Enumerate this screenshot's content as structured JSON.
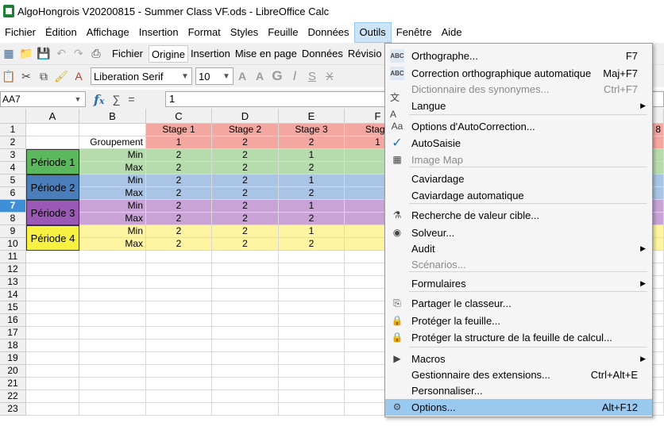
{
  "window": {
    "title": "AlgoHongrois V20200815  - Summer Class VF.ods - LibreOffice Calc"
  },
  "menubar": [
    "Fichier",
    "Édition",
    "Affichage",
    "Insertion",
    "Format",
    "Styles",
    "Feuille",
    "Données",
    "Outils",
    "Fenêtre",
    "Aide"
  ],
  "tabs": [
    "Fichier",
    "Origine",
    "Insertion",
    "Mise en page",
    "Données",
    "Révisio"
  ],
  "font": {
    "name": "Liberation Serif",
    "size": "10"
  },
  "formula": {
    "cell_ref": "AA7",
    "content": "1"
  },
  "columns": [
    "A",
    "B",
    "C",
    "D",
    "E",
    "F"
  ],
  "header_row1": [
    "Stage 1",
    "Stage 2",
    "Stage 3",
    "Stage"
  ],
  "header_row2": {
    "groupement": "Groupement",
    "values": [
      "1",
      "2",
      "2",
      "1"
    ]
  },
  "right_edge_label": "8",
  "periods": [
    {
      "name": "Période 1",
      "min": [
        "2",
        "2",
        "1"
      ],
      "max": [
        "2",
        "2",
        "2"
      ],
      "color": "#5cb85c",
      "light": "#b6dcae"
    },
    {
      "name": "Période 2",
      "min": [
        "2",
        "2",
        "1"
      ],
      "max": [
        "2",
        "2",
        "2"
      ],
      "color": "#4a7ebb",
      "light": "#a9c4e4"
    },
    {
      "name": "Période 3",
      "min": [
        "2",
        "2",
        "1"
      ],
      "max": [
        "2",
        "2",
        "2"
      ],
      "color": "#9b59b6",
      "light": "#c9a2d6"
    },
    {
      "name": "Période 4",
      "min": [
        "2",
        "2",
        "1"
      ],
      "max": [
        "2",
        "2",
        "2"
      ],
      "color": "#f7f241",
      "light": "#fef4a2"
    }
  ],
  "minmax": {
    "min": "Min",
    "max": "Max"
  },
  "row_numbers": [
    "1",
    "2",
    "3",
    "4",
    "5",
    "6",
    "7",
    "8",
    "9",
    "10",
    "11",
    "12",
    "13",
    "14",
    "15",
    "16",
    "17",
    "18",
    "19",
    "20",
    "21",
    "22",
    "23"
  ],
  "outils_menu": [
    {
      "label": "Orthographe...",
      "shortcut": "F7",
      "icon": "spellcheck-icon",
      "state": "normal"
    },
    {
      "label": "Correction orthographique automatique",
      "shortcut": "Maj+F7",
      "icon": "autospellcheck-icon",
      "state": "normal"
    },
    {
      "label": "Dictionnaire des synonymes...",
      "shortcut": "Ctrl+F7",
      "icon": "",
      "state": "disabled"
    },
    {
      "label": "Langue",
      "shortcut": "",
      "icon": "language-icon",
      "state": "submenu"
    },
    {
      "label": "Options d'AutoCorrection...",
      "shortcut": "",
      "icon": "autocorrect-icon",
      "state": "normal"
    },
    {
      "label": "AutoSaisie",
      "shortcut": "",
      "icon": "checkmark-icon",
      "state": "normal"
    },
    {
      "label": "Image Map",
      "shortcut": "",
      "icon": "image-map-icon",
      "state": "disabled"
    },
    {
      "label": "Caviardage",
      "shortcut": "",
      "icon": "",
      "state": "normal"
    },
    {
      "label": "Caviardage automatique",
      "shortcut": "",
      "icon": "",
      "state": "normal"
    },
    {
      "label": "Recherche de valeur cible...",
      "shortcut": "",
      "icon": "goal-seek-icon",
      "state": "normal"
    },
    {
      "label": "Solveur...",
      "shortcut": "",
      "icon": "solver-icon",
      "state": "normal"
    },
    {
      "label": "Audit",
      "shortcut": "",
      "icon": "",
      "state": "submenu"
    },
    {
      "label": "Scénarios...",
      "shortcut": "",
      "icon": "",
      "state": "disabled"
    },
    {
      "label": "Formulaires",
      "shortcut": "",
      "icon": "",
      "state": "submenu"
    },
    {
      "label": "Partager le classeur...",
      "shortcut": "",
      "icon": "share-icon",
      "state": "normal"
    },
    {
      "label": "Protéger la feuille...",
      "shortcut": "",
      "icon": "lock-icon",
      "state": "normal"
    },
    {
      "label": "Protéger la structure de la feuille de calcul...",
      "shortcut": "",
      "icon": "lock-icon",
      "state": "normal"
    },
    {
      "label": "Macros",
      "shortcut": "",
      "icon": "macro-icon",
      "state": "submenu"
    },
    {
      "label": "Gestionnaire des extensions...",
      "shortcut": "Ctrl+Alt+E",
      "icon": "",
      "state": "normal"
    },
    {
      "label": "Personnaliser...",
      "shortcut": "",
      "icon": "",
      "state": "normal"
    },
    {
      "label": "Options...",
      "shortcut": "Alt+F12",
      "icon": "gear-icon",
      "state": "highlighted"
    }
  ]
}
